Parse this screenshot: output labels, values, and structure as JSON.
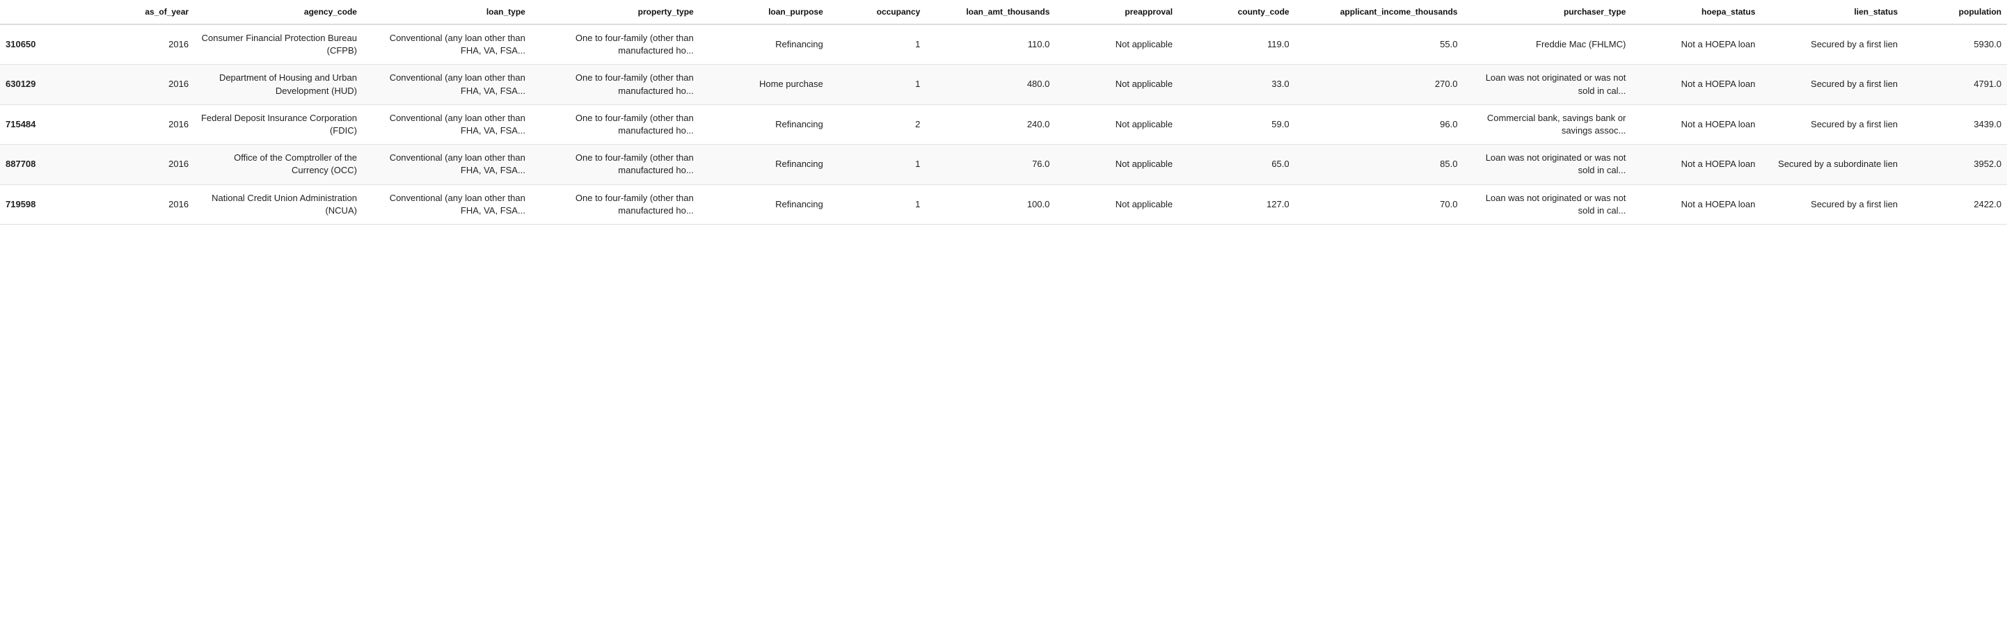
{
  "table": {
    "columns": [
      {
        "key": "id",
        "label": "",
        "align": "left"
      },
      {
        "key": "year",
        "label": "as_of_year",
        "align": "right"
      },
      {
        "key": "agency",
        "label": "agency_code",
        "align": "right"
      },
      {
        "key": "loanType",
        "label": "loan_type",
        "align": "right"
      },
      {
        "key": "propType",
        "label": "property_type",
        "align": "right"
      },
      {
        "key": "purpose",
        "label": "loan_purpose",
        "align": "right"
      },
      {
        "key": "occ",
        "label": "occupancy",
        "align": "right"
      },
      {
        "key": "amt",
        "label": "loan_amt_thousands",
        "align": "right"
      },
      {
        "key": "preapp",
        "label": "preapproval",
        "align": "right"
      },
      {
        "key": "county",
        "label": "county_code",
        "align": "right"
      },
      {
        "key": "income",
        "label": "applicant_income_thousands",
        "align": "right"
      },
      {
        "key": "purch",
        "label": "purchaser_type",
        "align": "right"
      },
      {
        "key": "hoepa",
        "label": "hoepa_status",
        "align": "right"
      },
      {
        "key": "lien",
        "label": "lien_status",
        "align": "right"
      },
      {
        "key": "pop",
        "label": "population",
        "align": "right"
      }
    ],
    "rows": [
      {
        "id": "310650",
        "year": "2016",
        "agency": "Consumer Financial Protection Bureau (CFPB)",
        "loanType": "Conventional (any loan other than FHA, VA, FSA...",
        "propType": "One to four-family (other than manufactured ho...",
        "purpose": "Refinancing",
        "occ": "1",
        "amt": "110.0",
        "preapp": "Not applicable",
        "county": "119.0",
        "income": "55.0",
        "purch": "Freddie Mac (FHLMC)",
        "hoepa": "Not a HOEPA loan",
        "lien": "Secured by a first lien",
        "pop": "5930.0"
      },
      {
        "id": "630129",
        "year": "2016",
        "agency": "Department of Housing and Urban Development (HUD)",
        "loanType": "Conventional (any loan other than FHA, VA, FSA...",
        "propType": "One to four-family (other than manufactured ho...",
        "purpose": "Home purchase",
        "occ": "1",
        "amt": "480.0",
        "preapp": "Not applicable",
        "county": "33.0",
        "income": "270.0",
        "purch": "Loan was not originated or was not sold in cal...",
        "hoepa": "Not a HOEPA loan",
        "lien": "Secured by a first lien",
        "pop": "4791.0"
      },
      {
        "id": "715484",
        "year": "2016",
        "agency": "Federal Deposit Insurance Corporation (FDIC)",
        "loanType": "Conventional (any loan other than FHA, VA, FSA...",
        "propType": "One to four-family (other than manufactured ho...",
        "purpose": "Refinancing",
        "occ": "2",
        "amt": "240.0",
        "preapp": "Not applicable",
        "county": "59.0",
        "income": "96.0",
        "purch": "Commercial bank, savings bank or savings assoc...",
        "hoepa": "Not a HOEPA loan",
        "lien": "Secured by a first lien",
        "pop": "3439.0"
      },
      {
        "id": "887708",
        "year": "2016",
        "agency": "Office of the Comptroller of the Currency (OCC)",
        "loanType": "Conventional (any loan other than FHA, VA, FSA...",
        "propType": "One to four-family (other than manufactured ho...",
        "purpose": "Refinancing",
        "occ": "1",
        "amt": "76.0",
        "preapp": "Not applicable",
        "county": "65.0",
        "income": "85.0",
        "purch": "Loan was not originated or was not sold in cal...",
        "hoepa": "Not a HOEPA loan",
        "lien": "Secured by a subordinate lien",
        "pop": "3952.0"
      },
      {
        "id": "719598",
        "year": "2016",
        "agency": "National Credit Union Administration (NCUA)",
        "loanType": "Conventional (any loan other than FHA, VA, FSA...",
        "propType": "One to four-family (other than manufactured ho...",
        "purpose": "Refinancing",
        "occ": "1",
        "amt": "100.0",
        "preapp": "Not applicable",
        "county": "127.0",
        "income": "70.0",
        "purch": "Loan was not originated or was not sold in cal...",
        "hoepa": "Not a HOEPA loan",
        "lien": "Secured by a first lien",
        "pop": "2422.0"
      }
    ]
  }
}
